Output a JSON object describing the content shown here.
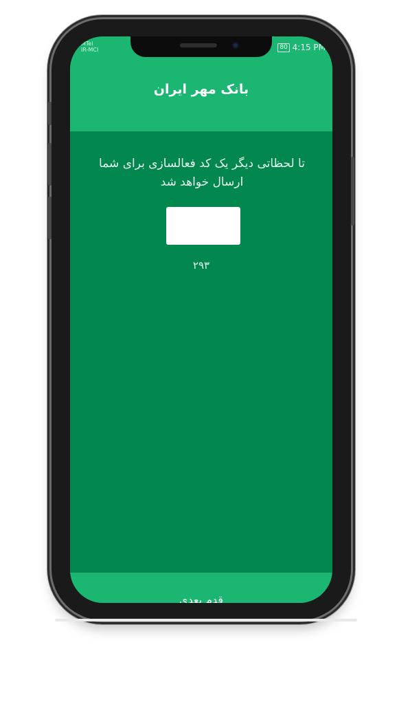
{
  "status_bar": {
    "carrier_lines": [
      "MTel",
      "IR-MCI"
    ],
    "battery": "80",
    "time": "4:15 PM"
  },
  "header": {
    "title": "بانک مهر ایران"
  },
  "main": {
    "message": "تا لحظاتی دیگر یک کد فعالسازی برای شما ارسال خواهد شد",
    "code_input_value": "",
    "countdown": "۲۹۳"
  },
  "footer": {
    "next_label": "قدم بعدی"
  },
  "colors": {
    "header_green": "#1cb673",
    "content_green": "#02884f",
    "text_white": "#ffffff"
  },
  "icons": [
    "signal-icon",
    "wifi-icon",
    "battery-icon"
  ]
}
